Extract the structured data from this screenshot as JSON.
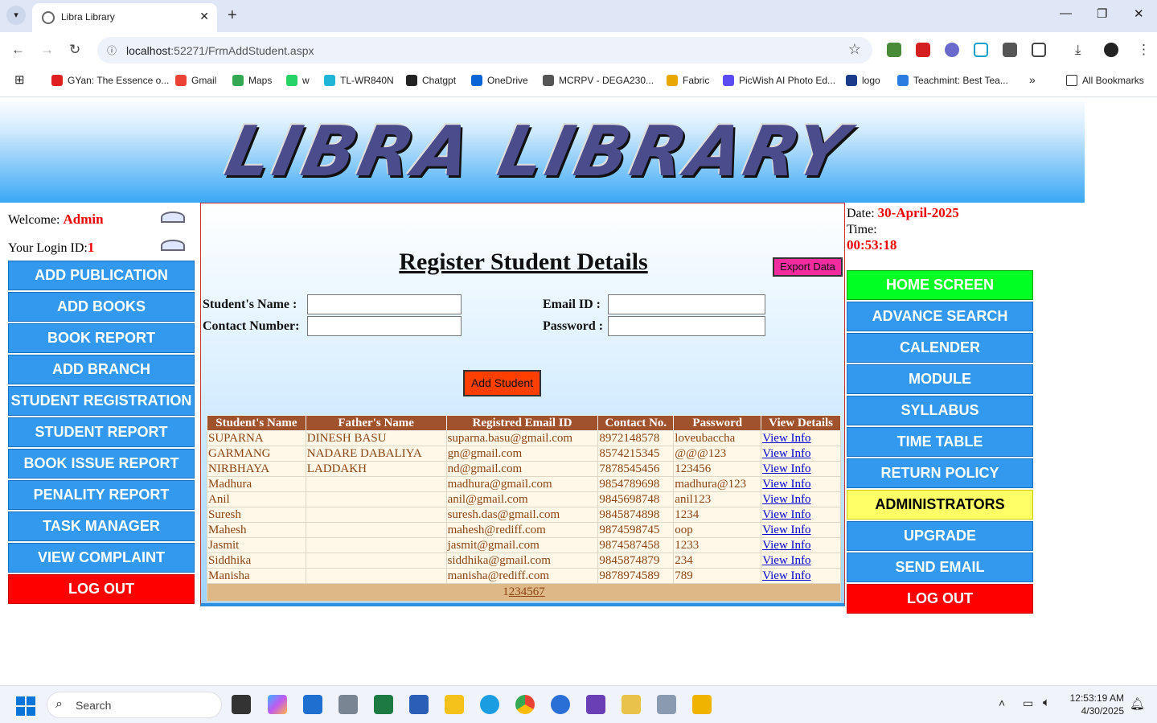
{
  "browser": {
    "tab_title": "Libra Library",
    "url_host": "localhost",
    "url_rest": ":52271/FrmAddStudent.aspx",
    "bookmarks": [
      {
        "label": "GYan: The Essence o...",
        "color": "#e02020"
      },
      {
        "label": "Gmail",
        "color": "#ea4335"
      },
      {
        "label": "Maps",
        "color": "#34a853"
      },
      {
        "label": "w",
        "color": "#25d366"
      },
      {
        "label": "TL-WR840N",
        "color": "#1fb5d6"
      },
      {
        "label": "Chatgpt",
        "color": "#222222"
      },
      {
        "label": "OneDrive",
        "color": "#0a64d6"
      },
      {
        "label": "MCRPV - DEGA230...",
        "color": "#555555"
      },
      {
        "label": "Fabric",
        "color": "#e8a800"
      },
      {
        "label": "PicWish AI Photo Ed...",
        "color": "#5a4cf0"
      },
      {
        "label": "logo",
        "color": "#1a3a8a"
      },
      {
        "label": "Teachmint: Best Tea...",
        "color": "#2a7de1"
      }
    ],
    "all_bookmarks": "All Bookmarks"
  },
  "site": {
    "logo_text": "LIBRA LIBRARY",
    "welcome_label": "Welcome: ",
    "welcome_user": "Admin",
    "login_label": "Your Login ID:",
    "login_id": "1",
    "date_label": "Date: ",
    "date_value": "30-April-2025",
    "time_label": "Time:",
    "time_value": "00:53:18"
  },
  "left_menu": [
    "ADD PUBLICATION",
    "ADD BOOKS",
    "BOOK REPORT",
    "ADD BRANCH",
    "STUDENT REGISTRATION",
    "STUDENT REPORT",
    "BOOK ISSUE REPORT",
    "PENALITY REPORT",
    "TASK MANAGER",
    "VIEW COMPLAINT",
    "LOG OUT"
  ],
  "right_menu": [
    "HOME SCREEN",
    "ADVANCE SEARCH",
    "CALENDER",
    "MODULE",
    "SYLLABUS",
    "TIME TABLE",
    "RETURN POLICY",
    "ADMINISTRATORS",
    "UPGRADE",
    "SEND EMAIL",
    "LOG OUT"
  ],
  "colors": {
    "menu_blue": "#3399ee",
    "home_green": "#00ff22",
    "admin_yellow": "#ffff66",
    "logout_red": "#ff0000"
  },
  "form": {
    "title": "Register Student Details",
    "export_label": "Export Data",
    "name_label": "Student's Name :",
    "contact_label": "Contact Number:",
    "email_label": "Email ID :",
    "password_label": "Password :",
    "name_value": "",
    "contact_value": "",
    "email_value": "",
    "password_value": "",
    "add_button": "Add Student"
  },
  "table": {
    "headers": [
      "Student's Name",
      "Father's Name",
      "Registred Email ID",
      "Contact No.",
      "Password",
      "View Details"
    ],
    "rows": [
      [
        "SUPARNA",
        "DINESH BASU",
        "suparna.basu@gmail.com",
        "8972148578",
        "loveubaccha",
        "View Info"
      ],
      [
        "GARMANG",
        "NADARE DABALIYA",
        "gn@gmail.com",
        "8574215345",
        "@@@123",
        "View Info"
      ],
      [
        "NIRBHAYA",
        "LADDAKH",
        "nd@gmail.com",
        "7878545456",
        "123456",
        "View Info"
      ],
      [
        "Madhura",
        "",
        "madhura@gmail.com",
        "9854789698",
        "madhura@123",
        "View Info"
      ],
      [
        "Anil",
        "",
        "anil@gmail.com",
        "9845698748",
        "anil123",
        "View Info"
      ],
      [
        "Suresh",
        "",
        "suresh.das@gmail.com",
        "9845874898",
        "1234",
        "View Info"
      ],
      [
        "Mahesh",
        "",
        "mahesh@rediff.com",
        "9874598745",
        "oop",
        "View Info"
      ],
      [
        "Jasmit",
        "",
        "jasmit@gmail.com",
        "9874587458",
        "1233",
        "View Info"
      ],
      [
        "Siddhika",
        "",
        "siddhika@gmail.com",
        "9845874879",
        "234",
        "View Info"
      ],
      [
        "Manisha",
        "",
        "manisha@rediff.com",
        "9878974589",
        "789",
        "View Info"
      ]
    ],
    "pages": [
      "1",
      "2",
      "3",
      "4",
      "5",
      "6",
      "7"
    ]
  },
  "taskbar": {
    "search_placeholder": "Search",
    "time": "12:53:19 AM",
    "date": "4/30/2025"
  }
}
